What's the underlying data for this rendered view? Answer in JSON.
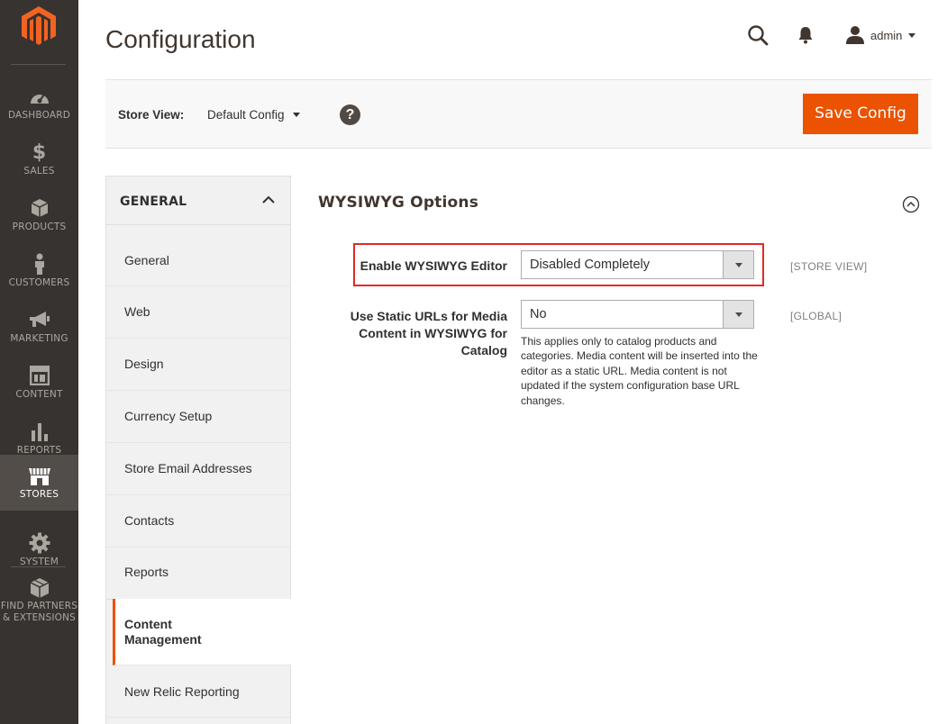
{
  "sidebar": {
    "items": [
      {
        "label": "DASHBOARD",
        "icon": "dashboard-icon"
      },
      {
        "label": "$",
        "sublabel": "SALES",
        "icon": "dollar-icon"
      },
      {
        "label": "PRODUCTS",
        "icon": "box-icon"
      },
      {
        "label": "CUSTOMERS",
        "icon": "person-icon"
      },
      {
        "label": "MARKETING",
        "icon": "megaphone-icon"
      },
      {
        "label": "CONTENT",
        "icon": "layout-icon"
      },
      {
        "label": "REPORTS",
        "icon": "bar-chart-icon"
      },
      {
        "label": "STORES",
        "icon": "storefront-icon",
        "active": true
      },
      {
        "label": "SYSTEM",
        "icon": "gear-icon"
      },
      {
        "label_line1": "FIND PARTNERS",
        "label_line2": "& EXTENSIONS",
        "icon": "extensions-icon"
      }
    ]
  },
  "header": {
    "title": "Configuration",
    "user": "admin"
  },
  "store_bar": {
    "label": "Store View:",
    "value": "Default Config",
    "help": "?",
    "save_label": "Save Config"
  },
  "tabs": {
    "group": "GENERAL",
    "items": [
      "General",
      "Web",
      "Design",
      "Currency Setup",
      "Store Email Addresses",
      "Contacts",
      "Reports",
      "Content Management",
      "New Relic Reporting"
    ],
    "active_line1": "Content",
    "active_line2": "Management"
  },
  "section": {
    "title": "WYSIWYG Options",
    "fields": [
      {
        "label": "Enable WYSIWYG Editor",
        "value": "Disabled Completely",
        "scope": "[STORE VIEW]"
      },
      {
        "label_lines": [
          "Use Static URLs for Media",
          "Content in WYSIWYG for",
          "Catalog"
        ],
        "value": "No",
        "scope": "[GLOBAL]",
        "note": "This applies only to catalog products and categories. Media content will be inserted into the editor as a static URL. Media content is not updated if the system configuration base URL changes."
      }
    ]
  },
  "colors": {
    "accent": "#eb5202",
    "sidebar_bg": "#373330",
    "highlight": "#e02b27"
  }
}
